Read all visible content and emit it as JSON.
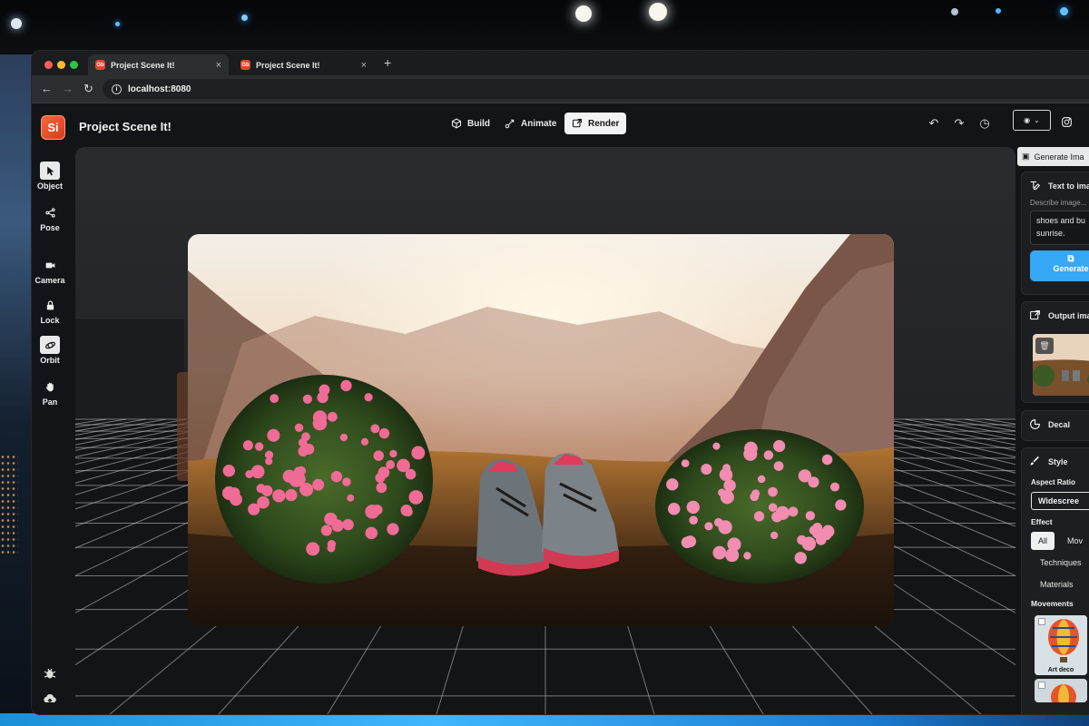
{
  "browser": {
    "tabs": [
      {
        "favicon": "Gb",
        "title": "Project Scene It!"
      },
      {
        "favicon": "Gb",
        "title": "Project Scene It!"
      }
    ],
    "new_tab": "+",
    "close_glyph": "×",
    "url": "localhost:8080"
  },
  "app": {
    "logo_text": "Si",
    "title": "Project Scene It!",
    "modes": [
      {
        "label": "Build",
        "icon": "cube-icon"
      },
      {
        "label": "Animate",
        "icon": "motion-icon"
      },
      {
        "label": "Render",
        "icon": "render-icon",
        "active": true
      }
    ],
    "toolbar_icons": [
      "undo-icon",
      "redo-icon",
      "history-icon",
      "view-eye-icon",
      "instagram-icon"
    ]
  },
  "rail": {
    "items": [
      {
        "label": "Object",
        "icon": "cursor-icon",
        "selected": false
      },
      {
        "label": "Pose",
        "icon": "pose-icon",
        "selected": false
      },
      {
        "label": "Camera",
        "icon": "camera-icon",
        "selected": false
      },
      {
        "label": "Lock",
        "icon": "lock-icon",
        "selected": false
      },
      {
        "label": "Orbit",
        "icon": "orbit-icon",
        "selected": true
      },
      {
        "label": "Pan",
        "icon": "hand-icon",
        "selected": false
      }
    ]
  },
  "panel": {
    "tab_label": "Generate Ima",
    "text_to_image": {
      "title": "Text to imag",
      "placeholder_label": "Describe image...",
      "prompt": "shoes and bu sunrise.",
      "button": "Generate"
    },
    "output": {
      "title": "Output ima"
    },
    "decal": {
      "title": "Decal"
    },
    "style": {
      "title": "Style",
      "aspect_label": "Aspect Ratio",
      "aspect_value": "Widescree",
      "effect_label": "Effect",
      "effect_chips": [
        "All",
        "Mov"
      ],
      "lines": [
        "Techniques",
        "Materials"
      ],
      "movements_label": "Movements",
      "movement_cards": [
        {
          "label": "Art deco"
        },
        {
          "label": ""
        }
      ]
    }
  },
  "colors": {
    "accent_blue": "#37a8f5",
    "logo_orange": "#e0452b",
    "app_bg": "#131417"
  }
}
